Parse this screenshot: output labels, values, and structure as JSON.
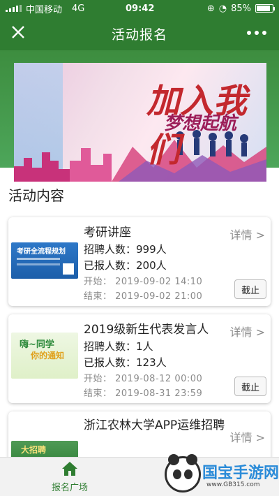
{
  "status_bar": {
    "carrier": "中国移动",
    "network": "4G",
    "time": "09:42",
    "battery": "85%",
    "battery_level": 0.85
  },
  "nav": {
    "title": "活动报名",
    "close_icon": "close-icon",
    "more_icon": "more-dots-icon"
  },
  "banner": {
    "text_main": "加入我们",
    "text_sub": "梦想起航"
  },
  "section": {
    "title": "活动内容"
  },
  "activities": [
    {
      "name": "考研讲座",
      "recruit": "招聘人数：999人",
      "enrolled": "已报人数：200人",
      "start": "开始：  2019-09-02 14:10",
      "end": "结束：  2019-09-02 21:00",
      "detail": "详情 >",
      "status": "截止",
      "thumb_text": "考研全流程规划"
    },
    {
      "name": "2019级新生代表发言人",
      "recruit": "招聘人数：1人",
      "enrolled": "已报人数：123人",
      "start": "开始：  2019-08-12 00:00",
      "end": "结束：  2019-08-31 23:59",
      "detail": "详情 >",
      "status": "截止",
      "thumb_text": "嗨~同学",
      "thumb_text2": "你的通知"
    },
    {
      "name": "浙江农林大学APP运维招聘",
      "detail": "详情 >",
      "thumb_text": "大招聘"
    }
  ],
  "tabbar": {
    "label": "报名广场"
  },
  "watermark": {
    "brand": "国宝手游网",
    "url": "www.GB315.com"
  },
  "colors": {
    "brand_green": "#2f7d31",
    "detail_gray": "#8b8b8b"
  }
}
